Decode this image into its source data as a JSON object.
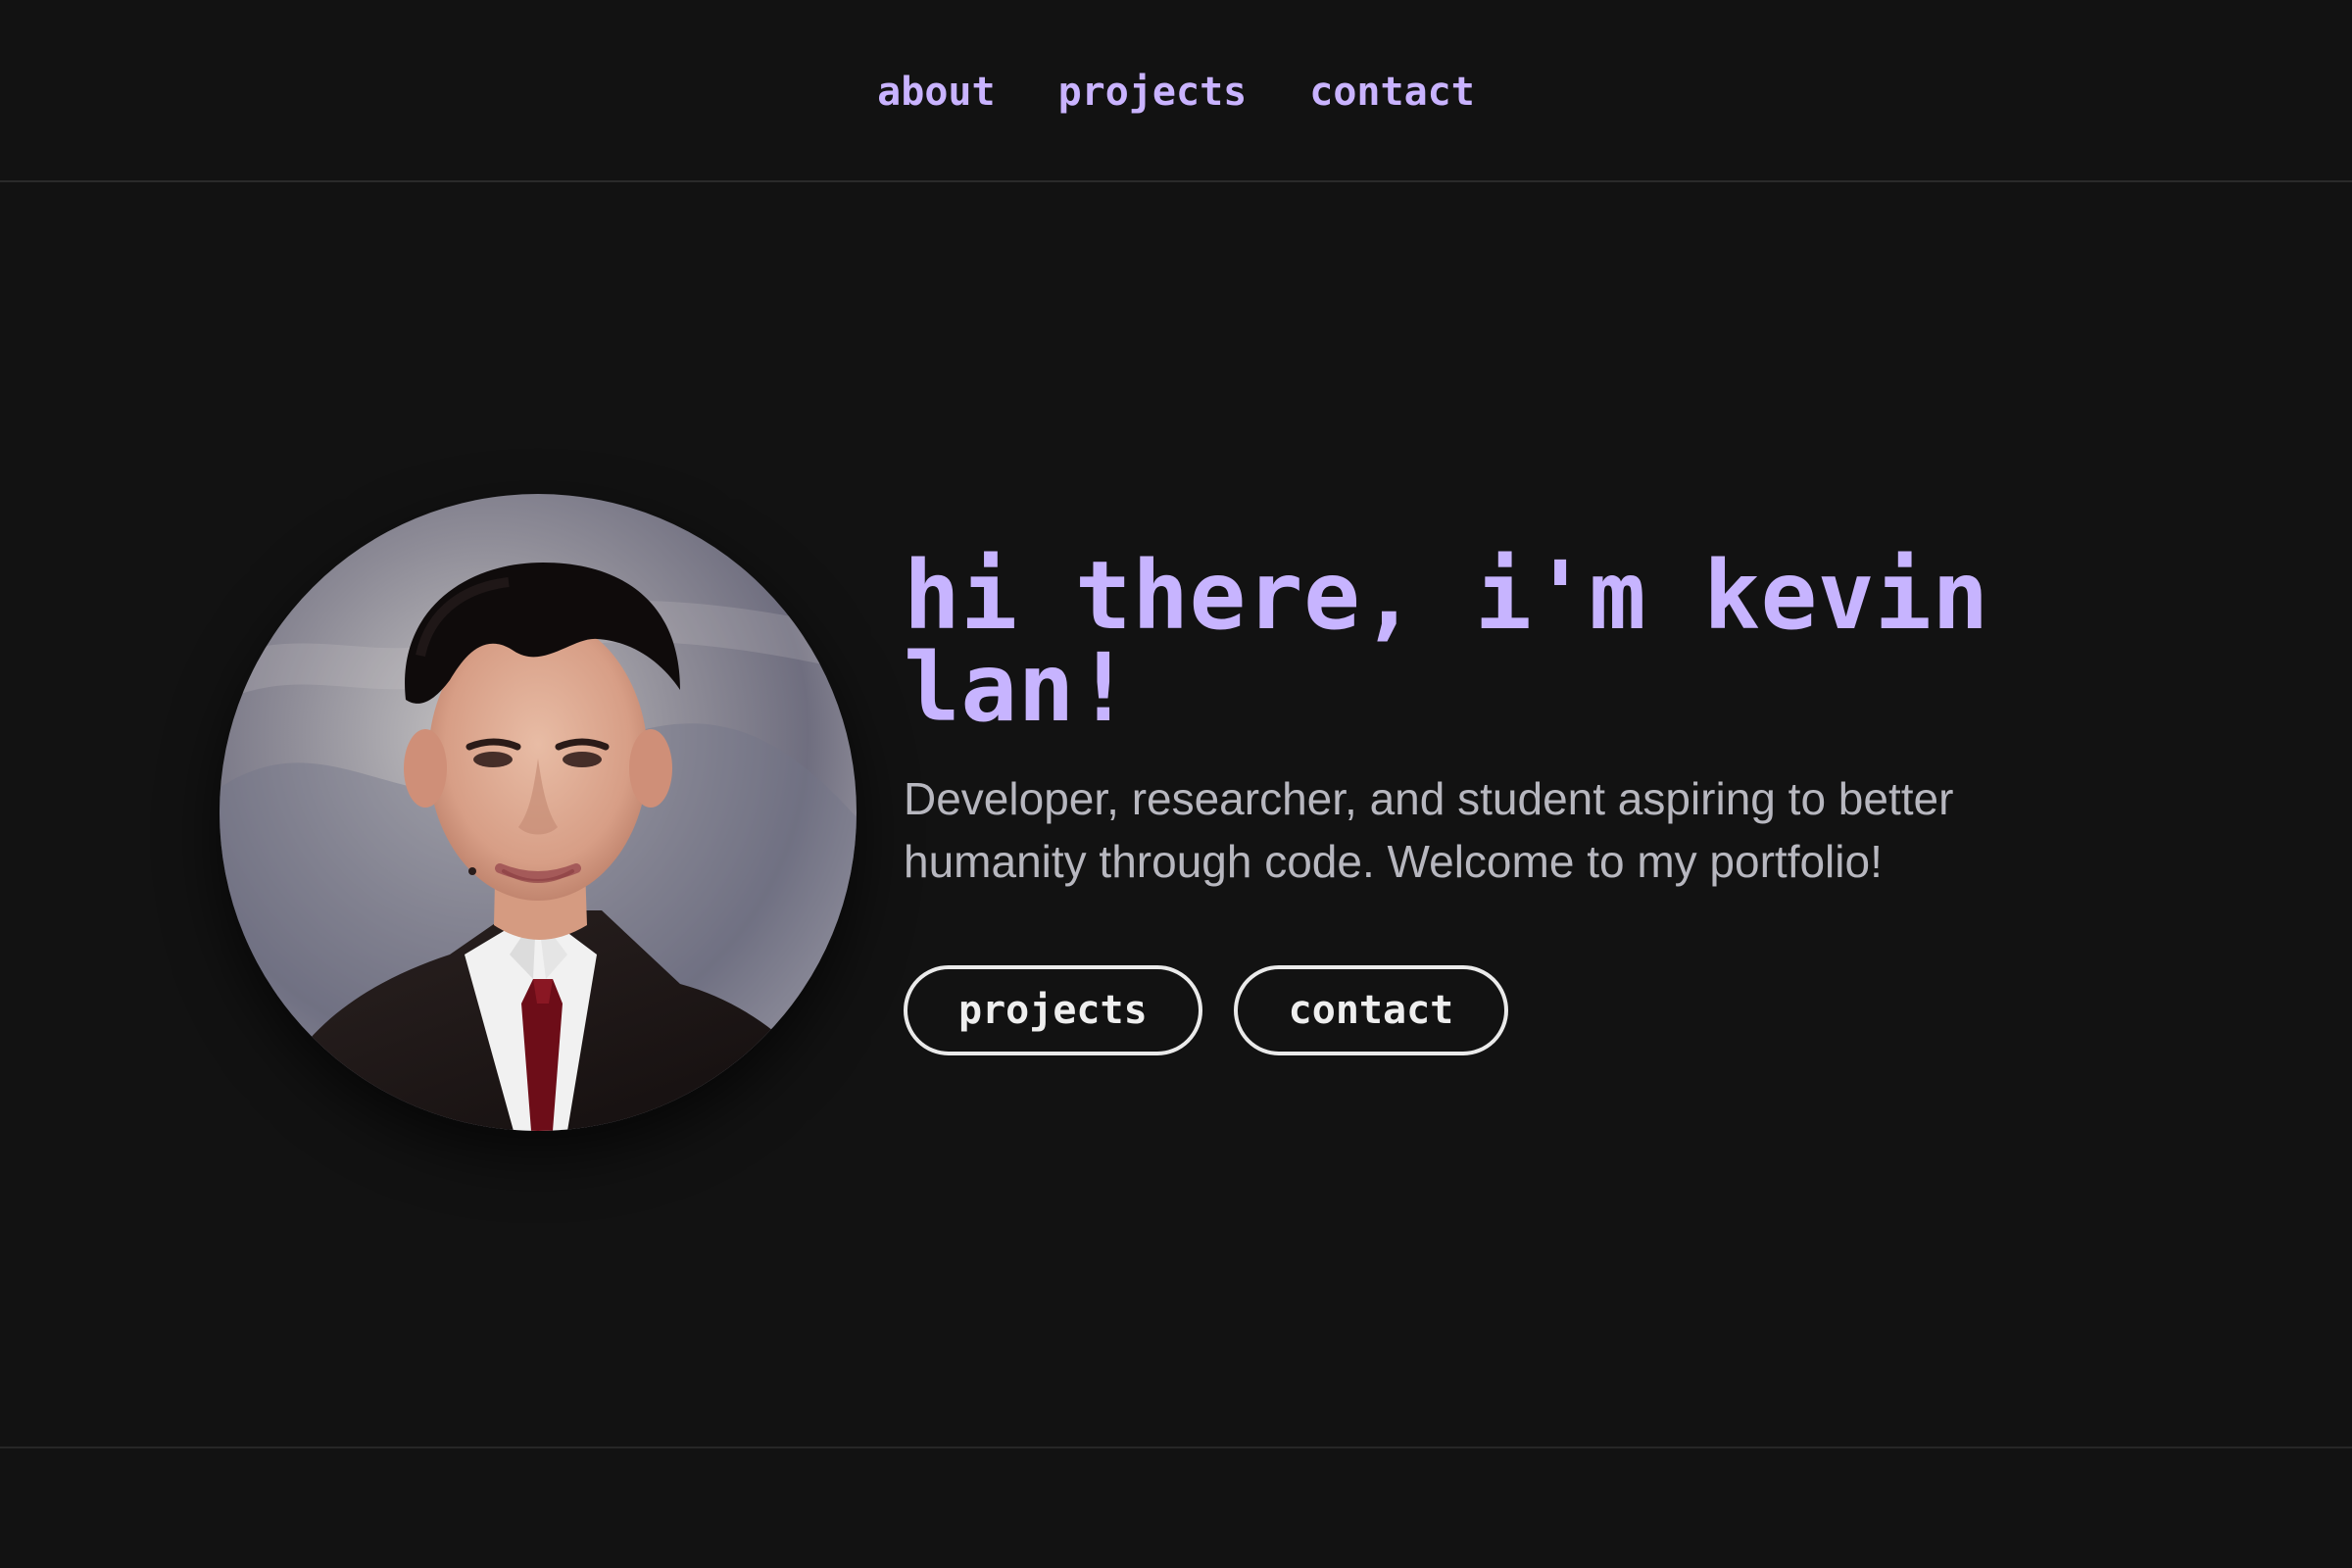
{
  "nav": {
    "items": [
      "about",
      "projects",
      "contact"
    ]
  },
  "hero": {
    "title": "hi there, i'm kevin lan!",
    "subtitle": "Developer, researcher, and student aspiring to better humanity through code. Welcome to my portfolio!",
    "buttons": [
      "projects",
      "contact"
    ]
  },
  "colors": {
    "background": "#121212",
    "accent": "#c7b4ff",
    "muted_text": "#b7b7bf",
    "button_border": "#eaeaea"
  },
  "icons": {
    "avatar": "avatar"
  }
}
